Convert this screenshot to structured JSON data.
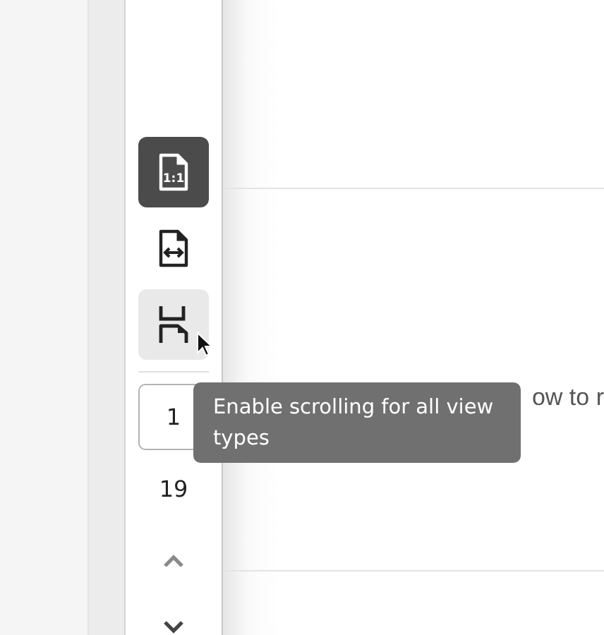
{
  "toolbar": {
    "view_buttons": [
      {
        "kind": "actual-size",
        "icon_text": "1:1",
        "selected": true,
        "hovered": false
      },
      {
        "kind": "fit-width",
        "selected": false,
        "hovered": false
      },
      {
        "kind": "scroll",
        "selected": false,
        "hovered": true
      }
    ],
    "page_navigation": {
      "current_page": "1",
      "total_pages": "19"
    }
  },
  "document": {
    "visible_text": "ow to r"
  },
  "tooltip": {
    "text": "Enable scrolling for all view types"
  }
}
